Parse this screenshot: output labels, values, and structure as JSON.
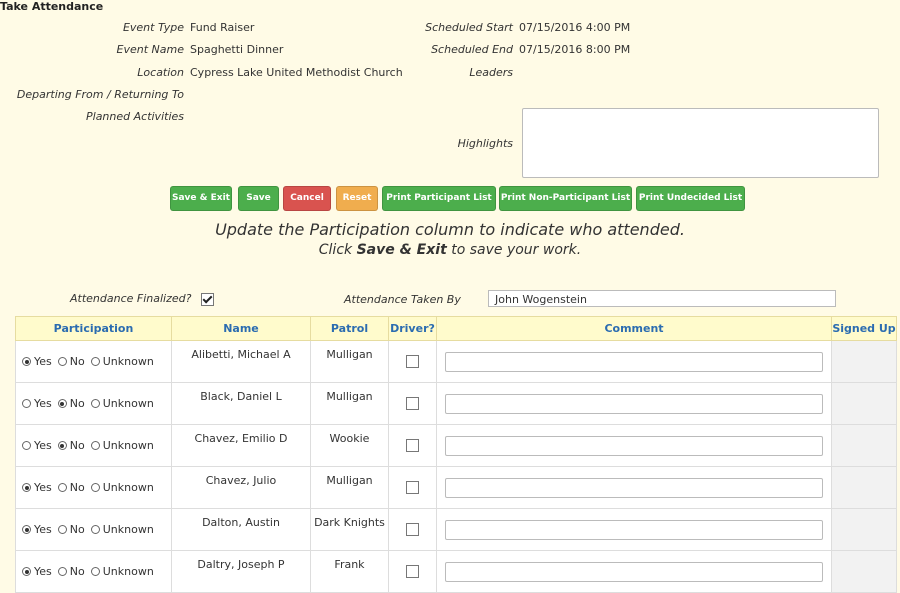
{
  "page": {
    "title": "Take Attendance"
  },
  "event": {
    "type_label": "Event Type",
    "type_value": "Fund Raiser",
    "name_label": "Event Name",
    "name_value": "Spaghetti Dinner",
    "location_label": "Location",
    "location_value": "Cypress Lake United Methodist Church",
    "departing_label": "Departing From / Returning To",
    "activities_label": "Planned Activities",
    "start_label": "Scheduled Start",
    "start_value": "07/15/2016 4:00 PM",
    "end_label": "Scheduled End",
    "end_value": "07/15/2016 8:00 PM",
    "leaders_label": "Leaders",
    "highlights_label": "Highlights"
  },
  "buttons": {
    "save_exit": "Save & Exit",
    "save": "Save",
    "cancel": "Cancel",
    "reset": "Reset",
    "print_participant": "Print Participant List",
    "print_non_participant": "Print Non-Participant List",
    "print_undecided": "Print Undecided List"
  },
  "instructions": {
    "line1": "Update the Participation column to indicate who attended.",
    "line2_pre": "Click ",
    "line2_bold": "Save & Exit",
    "line2_post": " to save your work."
  },
  "attendance": {
    "finalized_label": "Attendance Finalized?",
    "finalized": true,
    "taken_by_label": "Attendance Taken By",
    "taken_by_value": "John Wogenstein"
  },
  "table": {
    "headers": {
      "participation": "Participation",
      "name": "Name",
      "patrol": "Patrol",
      "driver": "Driver?",
      "comment": "Comment",
      "signed_up": "Signed Up"
    },
    "option_labels": {
      "yes": "Yes",
      "no": "No",
      "unknown": "Unknown"
    },
    "rows": [
      {
        "participation": "yes",
        "name": "Alibetti, Michael A",
        "patrol": "Mulligan"
      },
      {
        "participation": "no",
        "name": "Black, Daniel L",
        "patrol": "Mulligan"
      },
      {
        "participation": "no",
        "name": "Chavez, Emilio D",
        "patrol": "Wookie"
      },
      {
        "participation": "yes",
        "name": "Chavez, Julio",
        "patrol": "Mulligan"
      },
      {
        "participation": "yes",
        "name": "Dalton, Austin",
        "patrol": "Dark Knights"
      },
      {
        "participation": "yes",
        "name": "Daltry, Joseph P",
        "patrol": "Frank"
      }
    ]
  }
}
